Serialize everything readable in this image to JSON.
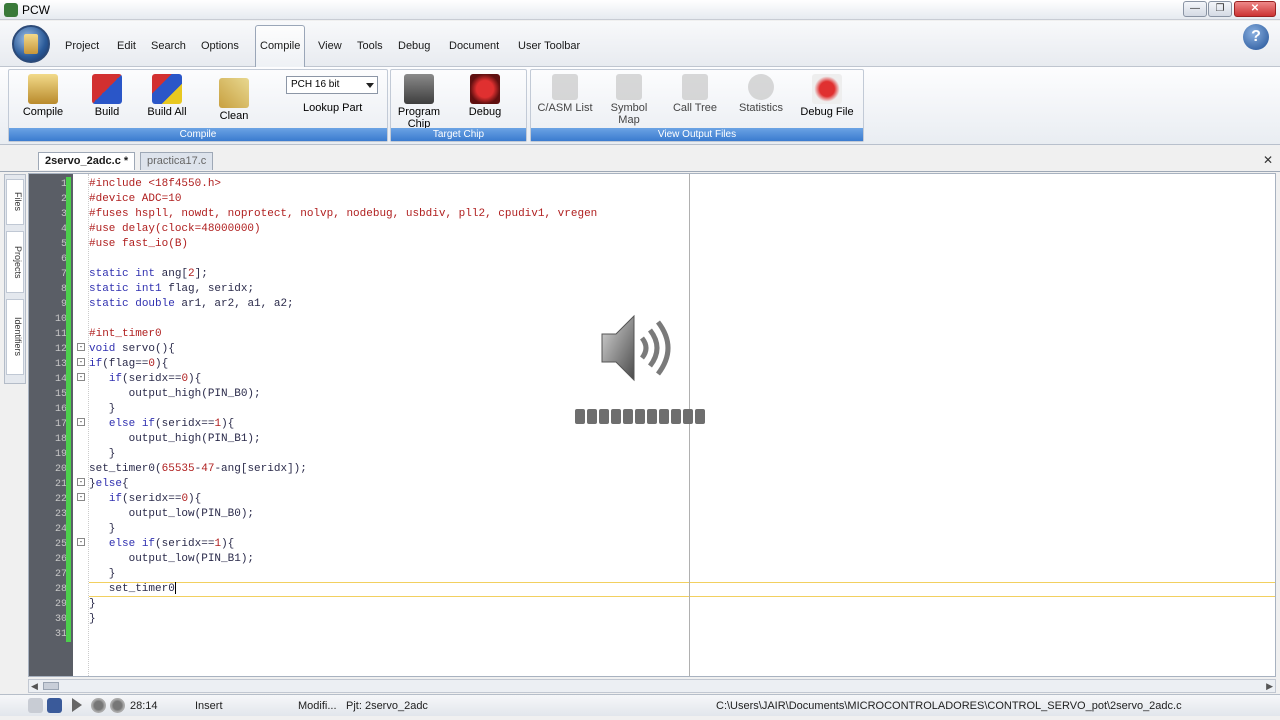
{
  "window": {
    "title": "PCW"
  },
  "menu": {
    "items": [
      {
        "label": "Project"
      },
      {
        "label": "Edit"
      },
      {
        "label": "Search"
      },
      {
        "label": "Options"
      },
      {
        "label": "Compile"
      },
      {
        "label": "View"
      },
      {
        "label": "Tools"
      },
      {
        "label": "Debug"
      },
      {
        "label": "Document"
      },
      {
        "label": "User Toolbar"
      }
    ]
  },
  "ribbon": {
    "compile_group": {
      "label": "Compile",
      "buttons": [
        {
          "label": "Compile"
        },
        {
          "label": "Build"
        },
        {
          "label": "Build All"
        },
        {
          "label": "Clean"
        }
      ],
      "compiler_select": "PCH 16 bit",
      "lookup_part": "Lookup Part"
    },
    "target_group": {
      "label": "Target Chip",
      "program_chip": "Program Chip",
      "debug": "Debug"
    },
    "output_group": {
      "label": "View Output Files",
      "buttons": [
        {
          "label": "C/ASM List"
        },
        {
          "label": "Symbol Map"
        },
        {
          "label": "Call Tree"
        },
        {
          "label": "Statistics"
        },
        {
          "label": "Debug File"
        }
      ]
    }
  },
  "tabs": [
    {
      "label": "2servo_2adc.c *"
    },
    {
      "label": "practica17.c"
    }
  ],
  "sidepanel": {
    "files": "Files",
    "projects": "Projects",
    "identifiers": "Identifiers"
  },
  "editor": {
    "lines": [
      "#include <18f4550.h>",
      "#device ADC=10",
      "#fuses hspll, nowdt, noprotect, nolvp, nodebug, usbdiv, pll2, cpudiv1, vregen",
      "#use delay(clock=48000000)",
      "#use fast_io(B)",
      "",
      "static int ang[2];",
      "static int1 flag, seridx;",
      "static double ar1, ar2, a1, a2;",
      "",
      "#int_timer0",
      "void servo(){",
      "if(flag==0){",
      "   if(seridx==0){",
      "      output_high(PIN_B0);",
      "   }",
      "   else if(seridx==1){",
      "      output_high(PIN_B1);",
      "   }",
      "set_timer0(65535-47-ang[seridx]);",
      "}else{",
      "   if(seridx==0){",
      "      output_low(PIN_B0);",
      "   }",
      "   else if(seridx==1){",
      "      output_low(PIN_B1);",
      "   }",
      "   set_timer0",
      "}",
      "}",
      ""
    ]
  },
  "volume": {
    "level": 1.0
  },
  "status": {
    "position": "28:14",
    "mode": "Insert",
    "modified": "Modifi...",
    "project": "Pjt: 2servo_2adc",
    "path": "C:\\Users\\JAIR\\Documents\\MICROCONTROLADORES\\CONTROL_SERVO_pot\\2servo_2adc.c"
  }
}
